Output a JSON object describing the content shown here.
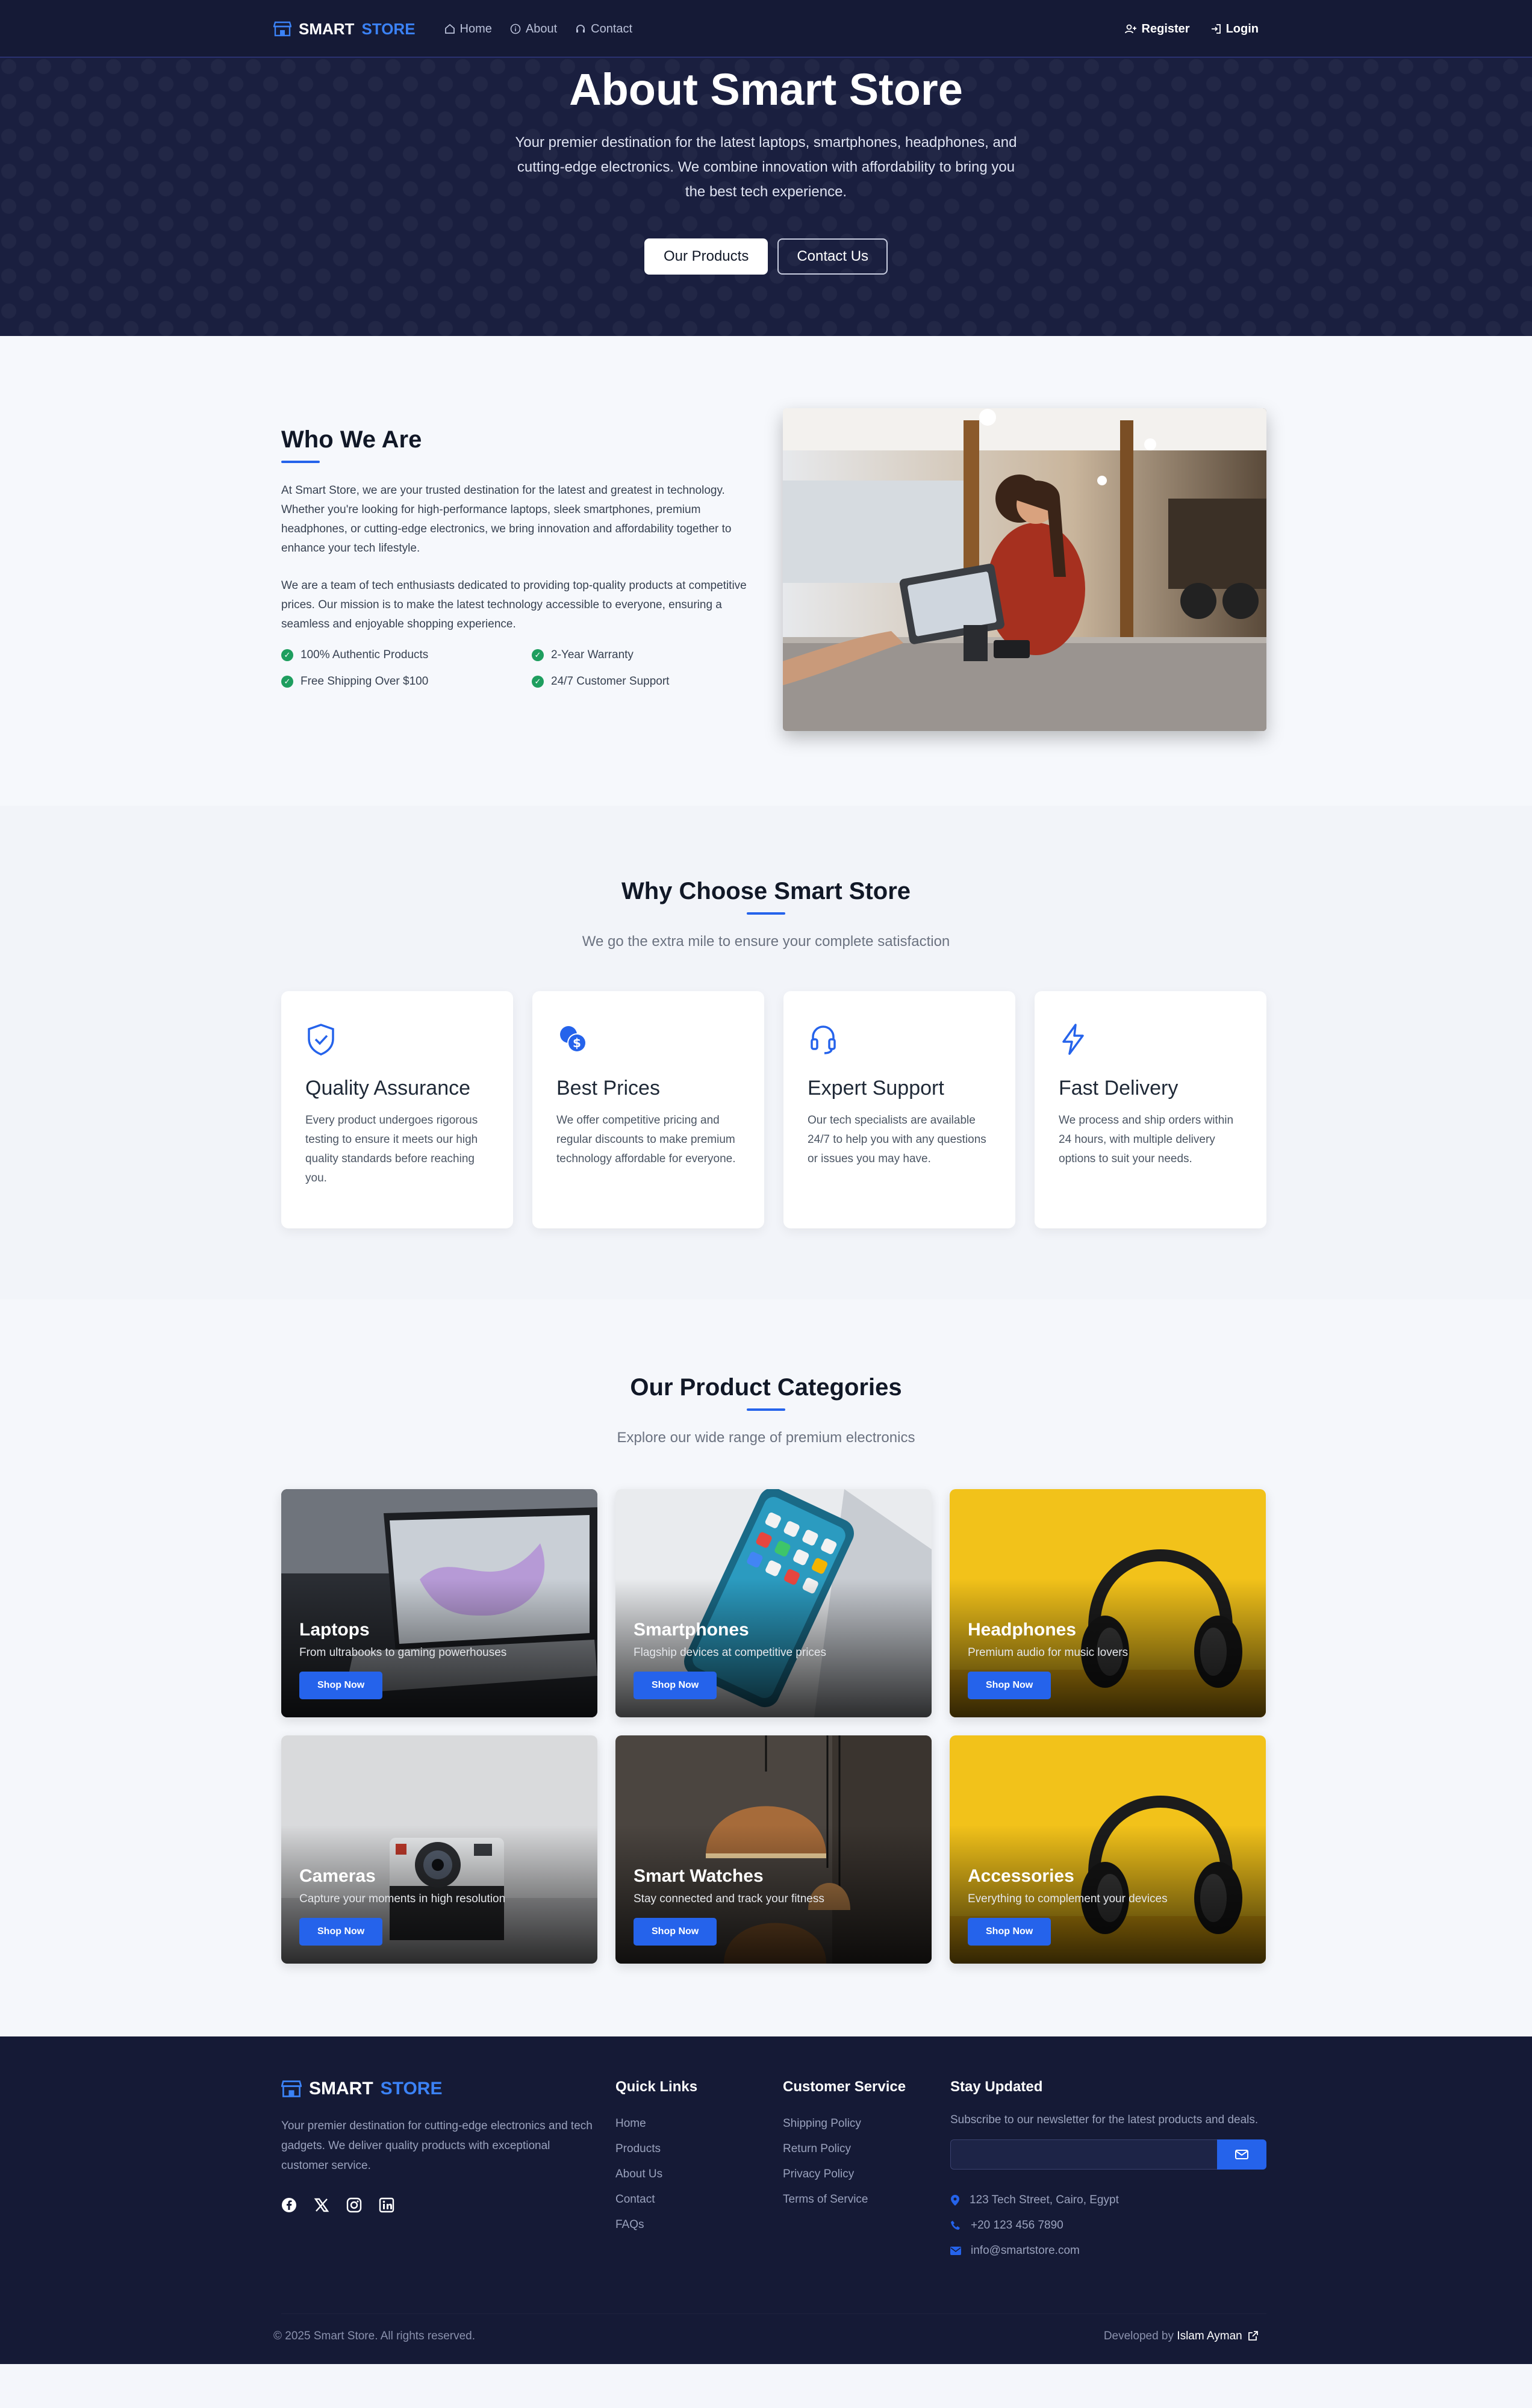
{
  "nav": {
    "brand_a": "SMART",
    "brand_b": "STORE",
    "links": [
      "Home",
      "About",
      "Contact"
    ],
    "register": "Register",
    "login": "Login"
  },
  "hero": {
    "title": "About Smart Store",
    "text": "Your premier destination for the latest laptops, smartphones, headphones, and cutting-edge electronics. We combine innovation with affordability to bring you the best tech experience.",
    "btn_products": "Our Products",
    "btn_contact": "Contact Us"
  },
  "who": {
    "title": "Who We Are",
    "para1": "At Smart Store, we are your trusted destination for the latest and greatest in technology. Whether you're looking for high-performance laptops, sleek smartphones, premium headphones, or cutting-edge electronics, we bring innovation and affordability together to enhance your tech lifestyle.",
    "para2": "We are a team of tech enthusiasts dedicated to providing top-quality products at competitive prices. Our mission is to make the latest technology accessible to everyone, ensuring a seamless and enjoyable shopping experience.",
    "features": [
      "100% Authentic Products",
      "2-Year Warranty",
      "Free Shipping Over $100",
      "24/7 Customer Support"
    ]
  },
  "why": {
    "title": "Why Choose Smart Store",
    "subtitle": "We go the extra mile to ensure your complete satisfaction",
    "cards": [
      {
        "icon": "shield-check-icon",
        "title": "Quality Assurance",
        "text": "Every product undergoes rigorous testing to ensure it meets our high quality standards before reaching you."
      },
      {
        "icon": "coins-dollar-icon",
        "title": "Best Prices",
        "text": "We offer competitive pricing and regular discounts to make premium technology affordable for everyone."
      },
      {
        "icon": "headset-icon",
        "title": "Expert Support",
        "text": "Our tech specialists are available 24/7 to help you with any questions or issues you may have."
      },
      {
        "icon": "lightning-icon",
        "title": "Fast Delivery",
        "text": "We process and ship orders within 24 hours, with multiple delivery options to suit your needs."
      }
    ]
  },
  "categories": {
    "title": "Our Product Categories",
    "subtitle": "Explore our wide range of premium electronics",
    "shop_label": "Shop Now",
    "items": [
      {
        "name": "Laptops",
        "desc": "From ultrabooks to gaming powerhouses"
      },
      {
        "name": "Smartphones",
        "desc": "Flagship devices at competitive prices"
      },
      {
        "name": "Headphones",
        "desc": "Premium audio for music lovers"
      },
      {
        "name": "Cameras",
        "desc": "Capture your moments in high resolution"
      },
      {
        "name": "Smart Watches",
        "desc": "Stay connected and track your fitness"
      },
      {
        "name": "Accessories",
        "desc": "Everything to complement your devices"
      }
    ]
  },
  "footer": {
    "brand_a": "SMART",
    "brand_b": "STORE",
    "desc": "Your premier destination for cutting-edge electronics and tech gadgets. We deliver quality products with exceptional customer service.",
    "quick_title": "Quick Links",
    "quick": [
      "Home",
      "Products",
      "About Us",
      "Contact",
      "FAQs"
    ],
    "service_title": "Customer Service",
    "service": [
      "Shipping Policy",
      "Return Policy",
      "Privacy Policy",
      "Terms of Service"
    ],
    "news_title": "Stay Updated",
    "news_text": "Subscribe to our newsletter for the latest products and deals.",
    "address": "123 Tech Street, Cairo, Egypt",
    "phone": "+20 123 456 7890",
    "email": "info@smartstore.com",
    "copyright": "© 2025 Smart Store. All rights reserved.",
    "dev_prefix": "Developed by",
    "dev_name": "Islam Ayman"
  },
  "colors": {
    "accent": "#2563eb",
    "navy": "#151a36",
    "success": "#1e9e5f"
  }
}
